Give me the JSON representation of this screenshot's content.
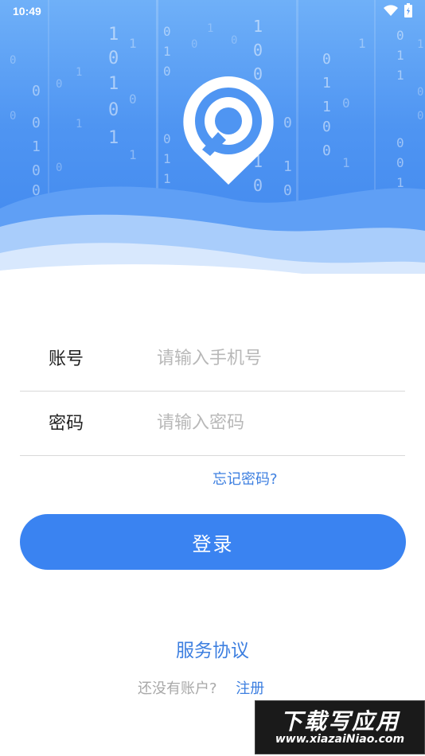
{
  "status_bar": {
    "time": "10:49"
  },
  "form": {
    "account": {
      "label": "账号",
      "placeholder": "请输入手机号"
    },
    "password": {
      "label": "密码",
      "placeholder": "请输入密码"
    },
    "forgot_label": "忘记密码?",
    "login_label": "登录"
  },
  "footer": {
    "agreement_label": "服务协议",
    "no_account_text": "还没有账户?",
    "register_label": "注册"
  },
  "watermark": {
    "title": "下载写应用",
    "url": "www.xiazaiNiao.com"
  },
  "colors": {
    "accent": "#3a83f1",
    "link": "#3d7fe0",
    "hero_top": "#6fb0f8",
    "hero_bottom": "#3f86ee"
  }
}
